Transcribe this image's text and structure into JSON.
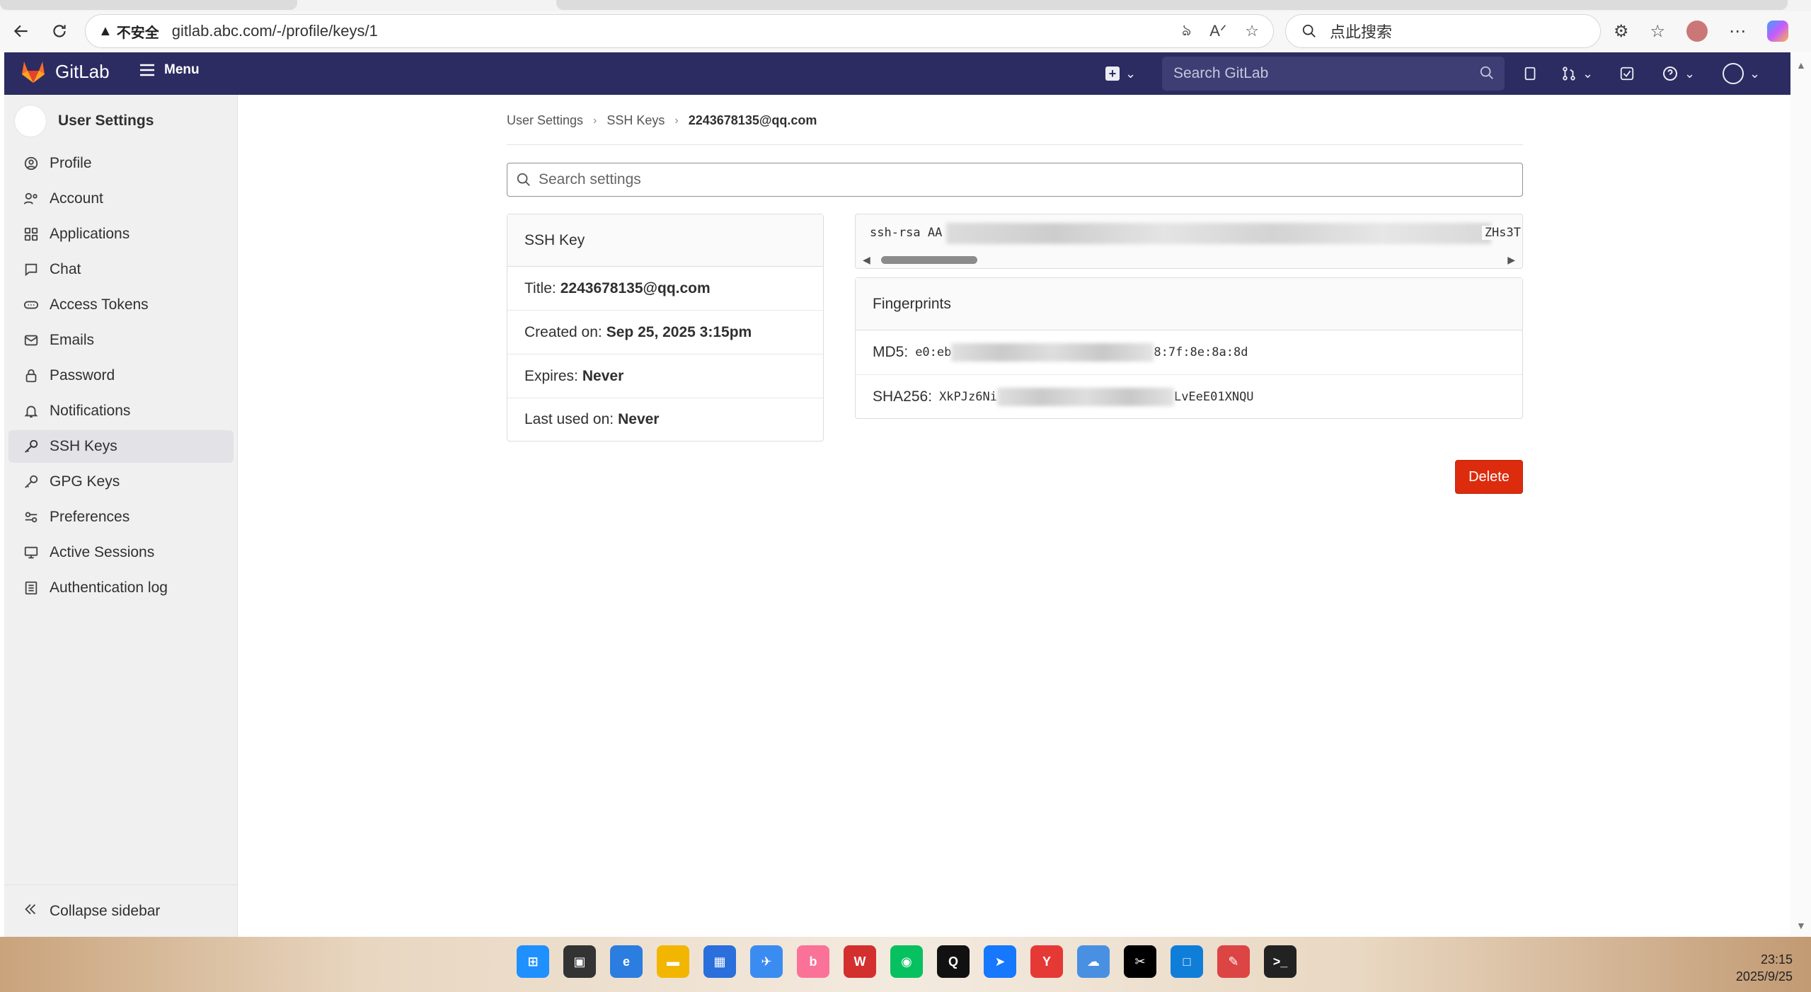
{
  "browser": {
    "security_label": "不安全",
    "url": "gitlab.abc.com/-/profile/keys/1",
    "search_placeholder": "点此搜索"
  },
  "topnav": {
    "brand": "GitLab",
    "menu_label": "Menu",
    "search_placeholder": "Search GitLab"
  },
  "sidebar": {
    "title": "User Settings",
    "items": [
      {
        "label": "Profile"
      },
      {
        "label": "Account"
      },
      {
        "label": "Applications"
      },
      {
        "label": "Chat"
      },
      {
        "label": "Access Tokens"
      },
      {
        "label": "Emails"
      },
      {
        "label": "Password"
      },
      {
        "label": "Notifications"
      },
      {
        "label": "SSH Keys",
        "active": true
      },
      {
        "label": "GPG Keys"
      },
      {
        "label": "Preferences"
      },
      {
        "label": "Active Sessions"
      },
      {
        "label": "Authentication log"
      }
    ],
    "collapse_label": "Collapse sidebar"
  },
  "breadcrumb": {
    "items": [
      "User Settings",
      "SSH Keys"
    ],
    "current": "2243678135@qq.com"
  },
  "settings_search": {
    "placeholder": "Search settings"
  },
  "ssh_key": {
    "header": "SSH Key",
    "title_label": "Title:",
    "title_value": "2243678135@qq.com",
    "created_label": "Created on:",
    "created_value": "Sep 25, 2025 3:15pm",
    "expires_label": "Expires:",
    "expires_value": "Never",
    "last_used_label": "Last used on:",
    "last_used_value": "Never"
  },
  "key_text": {
    "prefix": "ssh-rsa AA",
    "suffix": "ZHs3T"
  },
  "fingerprints": {
    "header": "Fingerprints",
    "md5_label": "MD5:",
    "md5_start": "e0:eb",
    "md5_end": "8:7f:8e:8a:8d",
    "sha256_label": "SHA256:",
    "sha256_start": "XkPJz6Ni",
    "sha256_end": "LvEeE01XNQU"
  },
  "actions": {
    "delete_label": "Delete"
  },
  "taskbar": {
    "time": "23:15",
    "date": "2025/9/25"
  },
  "colors": {
    "nav": "#2c2c62",
    "delete": "#dd2b0e",
    "sidebar": "#f0f0f0"
  }
}
